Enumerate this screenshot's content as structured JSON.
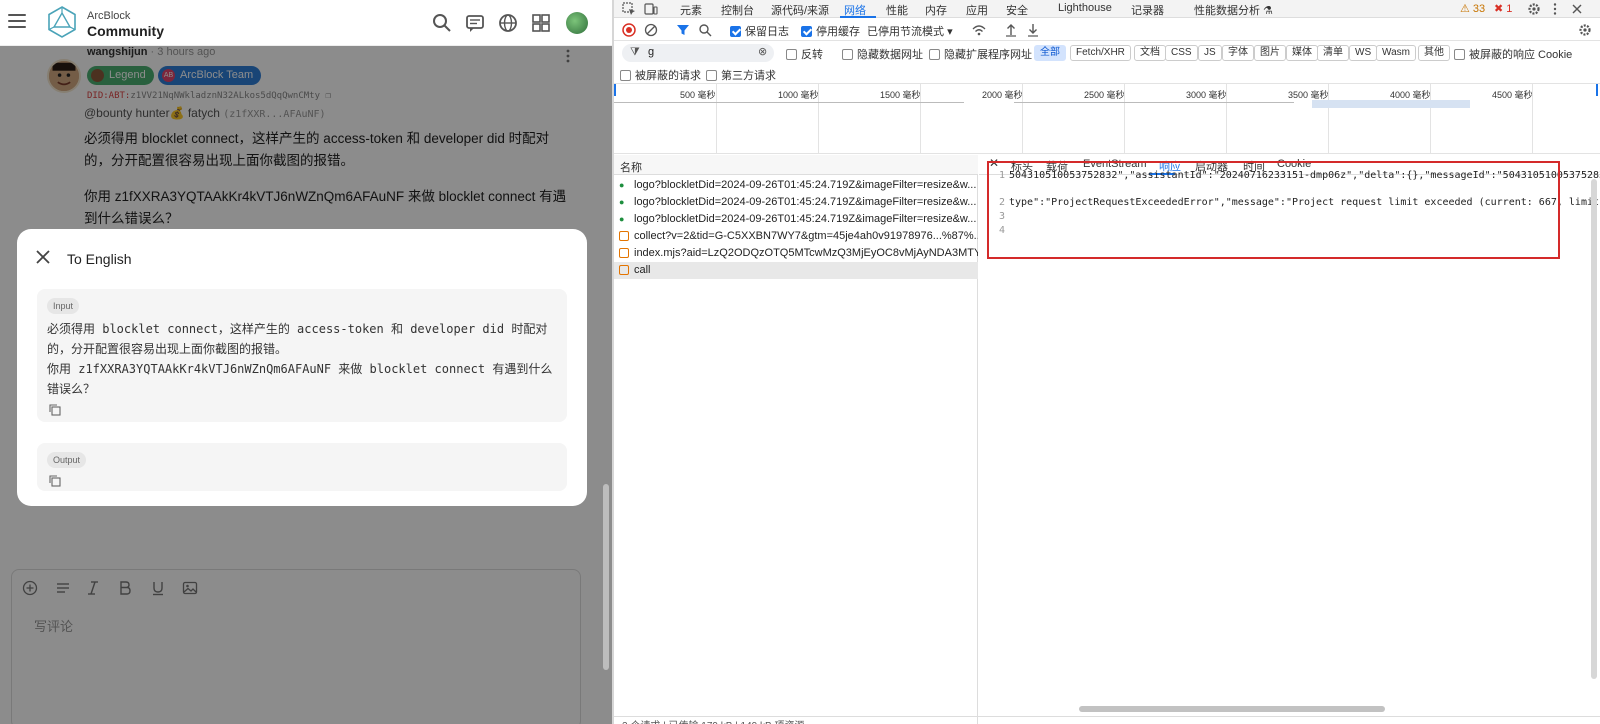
{
  "forum": {
    "brand_line1": "ArcBlock",
    "brand_line2": "Community",
    "post": {
      "author": "wangshijun",
      "time": " · 3 hours ago",
      "badge_legend": "Legend",
      "badge_team": "ArcBlock Team",
      "badge_team_abbr": "AB",
      "did_prefix": "DID:ABT:",
      "did_value": "z1VV21NqNWkladznN32ALkos5dQqQwnCMty",
      "mention_name": "@bounty hunter💰 fatych",
      "mention_addr": "(z1fXXR...AFAuNF)",
      "paragraph1": "必须得用 blocklet connect，这样产生的 access-token 和 developer did 时配对的，分开配置很容易出现上面你截图的报错。",
      "paragraph2": "你用 z1fXXRA3YQTAAkKr4kVTJ6nWZnQm6AFAuNF 来做 blocklet connect 有遇到什么错误么？"
    },
    "modal": {
      "title": "To English",
      "input_label": "Input",
      "input_text_1": "必须得用 blocklet connect，这样产生的 access-token 和 developer did 时配对的，分开配置很容易出现上面你截图的报错。",
      "input_text_2": "你用 z1fXXRA3YQTAAkKr4kVTJ6nWZnQm6AFAuNF 来做 blocklet connect 有遇到什么错误么？",
      "output_label": "Output"
    },
    "editor": {
      "placeholder": "写评论"
    }
  },
  "devtools": {
    "tabs": [
      "元素",
      "控制台",
      "源代码/来源",
      "网络",
      "性能",
      "内存",
      "应用",
      "安全",
      "Lighthouse",
      "记录器",
      "性能数据分析 ⚗"
    ],
    "active_tab": "网络",
    "warnings_count": "33",
    "errors_count": "1",
    "toolbar": {
      "preserve_log": "保留日志",
      "disable_cache": "停用缓存",
      "throttle": "已停用节流模式"
    },
    "filter": {
      "value": "g",
      "invert": "反转",
      "hide_data_urls": "隐藏数据网址",
      "hide_extension_urls": "隐藏扩展程序网址",
      "types": [
        "全部",
        "Fetch/XHR",
        "文档",
        "CSS",
        "JS",
        "字体",
        "图片",
        "媒体",
        "清单",
        "WS",
        "Wasm",
        "其他"
      ],
      "active_type": "全部",
      "blocked_response_cookies": "被屏蔽的响应 Cookie",
      "blocked_requests": "被屏蔽的请求",
      "third_party": "第三方请求"
    },
    "timeline_labels": [
      "500 毫秒",
      "1000 毫秒",
      "1500 毫秒",
      "2000 毫秒",
      "2500 毫秒",
      "3000 毫秒",
      "3500 毫秒",
      "4000 毫秒",
      "4500 毫秒"
    ],
    "request_list": {
      "header": "名称",
      "rows": [
        "logo?blockletDid=2024-09-26T01:45:24.719Z&imageFilter=resize&w...",
        "logo?blockletDid=2024-09-26T01:45:24.719Z&imageFilter=resize&w...",
        "logo?blockletDid=2024-09-26T01:45:24.719Z&imageFilter=resize&w...",
        "collect?v=2&tid=G-C5XXBN7WY7&gtm=45je4ah0v91978976...%87%...",
        "index.mjs?aid=LzQ2ODQzOTQ5MTcwMzQ3MjEyOC8vMjAyNDA3MTY...",
        "call"
      ]
    },
    "detail": {
      "tabs": [
        "标头",
        "载荷",
        "EventStream",
        "响应",
        "启动器",
        "时间",
        "Cookie"
      ],
      "active_tab": "响应",
      "line1": "504310510053752832\",\"assistantId\":\"20240716233151-dmp06z\",\"delta\":{},\"messageId\":\"504310510053752832\",",
      "line2": "type\":\"ProjectRequestExceededError\",\"message\":\"Project request limit exceeded (current: 667, limit: 12"
    },
    "status_bar": "2 个请求  |  已传输 179 kB  |  149 kB 项资源"
  }
}
